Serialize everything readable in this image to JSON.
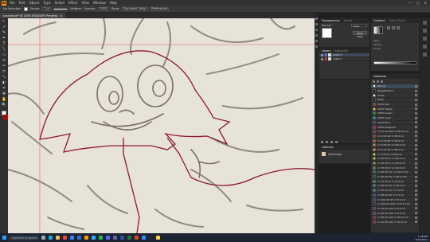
{
  "app": {
    "logo_text": "Ai",
    "menus": [
      "File",
      "Edit",
      "Object",
      "Type",
      "Select",
      "Effect",
      "View",
      "Window",
      "Help"
    ],
    "window_controls": [
      "—",
      "□",
      "✕"
    ]
  },
  "controlbar": {
    "selection_label": "No Selection",
    "stroke_label": "Stroke:",
    "stroke_value": "1 pt",
    "uniform_label": "Uniform",
    "opacity_label": "Opacity:",
    "opacity_value": "100%",
    "style_label": "Style:",
    "doc_setup": "Document Setup",
    "preferences": "Preferences"
  },
  "document_tab": {
    "title": "scanline.ai* @ 150% (RGB/GPU Preview)",
    "close": "×"
  },
  "tools": [
    "↖",
    "↗",
    "✎",
    "✒",
    "T",
    "╲",
    "▭",
    "⬭",
    "✂",
    "⟳",
    "⤡",
    "◐",
    "⌗",
    "✥",
    "✋",
    "🔍"
  ],
  "status": {
    "zoom": "150%",
    "angle": "0°",
    "page": "1",
    "tool": "Selection"
  },
  "transparency_panel": {
    "tabs": [
      "Transparency",
      "Stroke"
    ],
    "active_tab": "Transparency",
    "blend_mode": "Normal",
    "opacity": "100%",
    "make_mask": "Make Mask",
    "clip": "Clip",
    "invert": "Invert Mask"
  },
  "layers_panel": {
    "tabs": [
      "Layers",
      "Artboards"
    ],
    "active_tab": "Layers",
    "layers": [
      {
        "name": "Layer 2",
        "selected": true
      },
      {
        "name": "Layer 1",
        "selected": false
      }
    ]
  },
  "libraries_panel": {
    "tabs": [
      "Libraries"
    ],
    "item": "Sketchsign"
  },
  "gradient_panel": {
    "tabs": [
      "Gradient",
      "Color Guide"
    ],
    "active_tab": "Gradient",
    "type_label": "Type:",
    "stroke_label": "Stroke:",
    "angle_label": "Angle:"
  },
  "swatches_panel": {
    "tabs": [
      "Swatches"
    ],
    "swatches": [
      {
        "name": "[None]",
        "color": "#ffffff",
        "selected": true
      },
      {
        "name": "[Registration]",
        "color": "#000000",
        "selected": false
      },
      {
        "name": "White",
        "color": "#ffffff",
        "selected": false
      },
      {
        "name": "Black",
        "color": "#000000",
        "selected": false
      },
      {
        "name": "CMYK Red",
        "color": "#e11c1c",
        "selected": false
      },
      {
        "name": "CMYK Yellow",
        "color": "#ffe600",
        "selected": false
      },
      {
        "name": "CMYK Green",
        "color": "#00a651",
        "selected": false
      },
      {
        "name": "CMYK Cyan",
        "color": "#00aeef",
        "selected": false
      },
      {
        "name": "CMYK Blue",
        "color": "#2e3192",
        "selected": false
      },
      {
        "name": "CMYK Magenta",
        "color": "#ec008c",
        "selected": false
      },
      {
        "name": "C=15 M=100 Y=90 K=10",
        "color": "#c1272d",
        "selected": false
      },
      {
        "name": "C=0 M=90 Y=85 K=0",
        "color": "#ed1c24",
        "selected": false
      },
      {
        "name": "C=0 M=80 Y=95 K=0",
        "color": "#f15a24",
        "selected": false
      },
      {
        "name": "C=0 M=50 Y=100 K=0",
        "color": "#f7931e",
        "selected": false
      },
      {
        "name": "C=0 M=35 Y=85 K=0",
        "color": "#fbb03b",
        "selected": false
      },
      {
        "name": "C=5 M=0 Y=90 K=0",
        "color": "#fcee21",
        "selected": false
      },
      {
        "name": "C=20 M=0 Y=100 K=0",
        "color": "#d9e021",
        "selected": false
      },
      {
        "name": "C=50 M=0 Y=100 K=0",
        "color": "#8cc63f",
        "selected": false
      },
      {
        "name": "C=75 M=0 Y=100 K=0",
        "color": "#39b54a",
        "selected": false
      },
      {
        "name": "C=85 M=10 Y=100 K=10",
        "color": "#009245",
        "selected": false
      },
      {
        "name": "C=90 M=30 Y=95 K=30",
        "color": "#006837",
        "selected": false
      },
      {
        "name": "C=75 M=0 Y=75 K=0",
        "color": "#22b573",
        "selected": false
      },
      {
        "name": "C=80 M=10 Y=45 K=0",
        "color": "#00a99d",
        "selected": false
      },
      {
        "name": "C=70 M=15 Y=0 K=0",
        "color": "#29abe2",
        "selected": false
      },
      {
        "name": "C=85 M=50 Y=0 K=0",
        "color": "#0071bc",
        "selected": false
      },
      {
        "name": "C=100 M=95 Y=5 K=0",
        "color": "#2e3192",
        "selected": false
      },
      {
        "name": "C=100 M=100 Y=25 K=25",
        "color": "#1b1464",
        "selected": false
      },
      {
        "name": "C=75 M=100 Y=0 K=0",
        "color": "#662d91",
        "selected": false
      },
      {
        "name": "C=50 M=100 Y=0 K=0",
        "color": "#93278f",
        "selected": false
      },
      {
        "name": "C=35 M=100 Y=35 K=10",
        "color": "#9e005d",
        "selected": false
      },
      {
        "name": "C=10 M=100 Y=50 K=0",
        "color": "#d4145a",
        "selected": false
      }
    ]
  },
  "taskbar": {
    "search_placeholder": "Type here to search",
    "apps": [
      {
        "name": "task-view",
        "color": "#9aa7b8"
      },
      {
        "name": "edge",
        "color": "#1ea7e1"
      },
      {
        "name": "explorer",
        "color": "#f2c14e"
      },
      {
        "name": "chrome",
        "color": "#e84a3c"
      },
      {
        "name": "store",
        "color": "#3b82f6"
      },
      {
        "name": "mail",
        "color": "#2f6fd8"
      },
      {
        "name": "illustrator",
        "color": "#ff9a00"
      },
      {
        "name": "photoshop",
        "color": "#31a8ff"
      },
      {
        "name": "spotify",
        "color": "#1db954"
      },
      {
        "name": "discord",
        "color": "#5865f2"
      },
      {
        "name": "teams",
        "color": "#6264a7"
      },
      {
        "name": "word",
        "color": "#2b579a"
      },
      {
        "name": "excel",
        "color": "#217346"
      },
      {
        "name": "powerpoint",
        "color": "#d24726"
      },
      {
        "name": "zoom",
        "color": "#2d8cff"
      },
      {
        "name": "steam",
        "color": "#1b2838"
      },
      {
        "name": "notes",
        "color": "#ffd24a"
      }
    ],
    "time": "1:48 PM",
    "date": "5/21/2021"
  },
  "colors": {
    "accent": "#ff9a00",
    "path_stroke": "#8a1b2b",
    "guide": "#e85a5a",
    "paper": "#e8e3d8"
  }
}
